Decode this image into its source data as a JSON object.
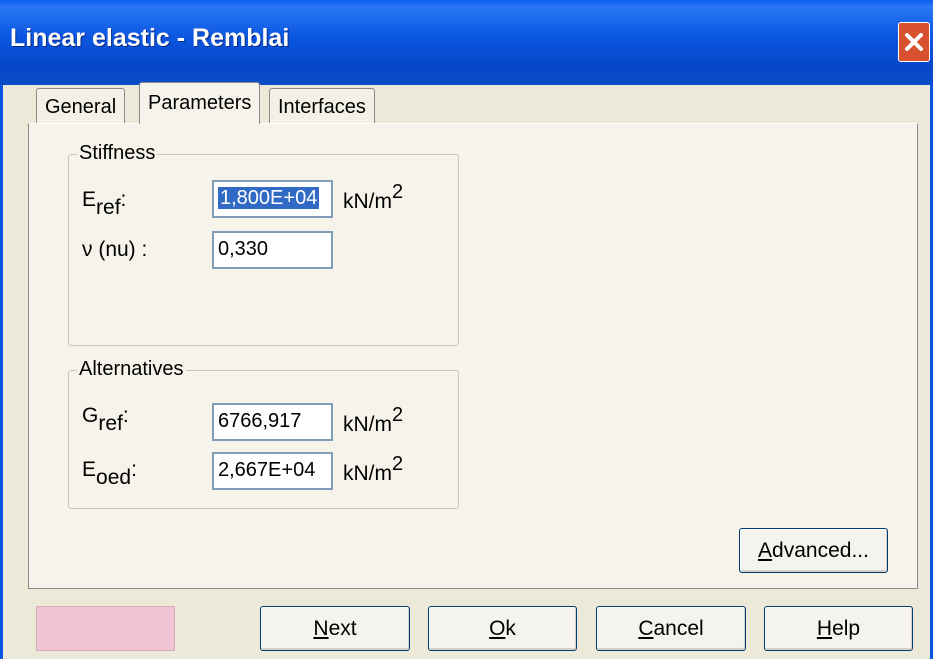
{
  "window": {
    "title": "Linear elastic - Remblai"
  },
  "tabs": [
    {
      "label": "General"
    },
    {
      "label": "Parameters"
    },
    {
      "label": "Interfaces"
    }
  ],
  "stiffness": {
    "group_label": "Stiffness",
    "e_ref": {
      "symbol": "E",
      "subscript": "ref",
      "colon": ":",
      "value": "1,800E+04",
      "unit": "kN/m",
      "unit_exp": "2"
    },
    "nu": {
      "label": "ν (nu) :",
      "value": "0,330"
    }
  },
  "alternatives": {
    "group_label": "Alternatives",
    "g_ref": {
      "symbol": "G",
      "subscript": "ref",
      "colon": ":",
      "value": "6766,917",
      "unit": "kN/m",
      "unit_exp": "2"
    },
    "e_oed": {
      "symbol": "E",
      "subscript": "oed",
      "colon": ":",
      "value": "2,667E+04",
      "unit": "kN/m",
      "unit_exp": "2"
    }
  },
  "buttons": {
    "advanced": {
      "pre": "",
      "key": "A",
      "post": "dvanced..."
    },
    "next": {
      "pre": "",
      "key": "N",
      "post": "ext"
    },
    "ok": {
      "pre": "",
      "key": "O",
      "post": "k"
    },
    "cancel": {
      "pre": "",
      "key": "C",
      "post": "ancel"
    },
    "help": {
      "pre": "",
      "key": "H",
      "post": "elp"
    }
  },
  "colors": {
    "title_bar": "#0a55e0",
    "material_swatch": "#f0c5d4",
    "selection": "#316ac5"
  }
}
